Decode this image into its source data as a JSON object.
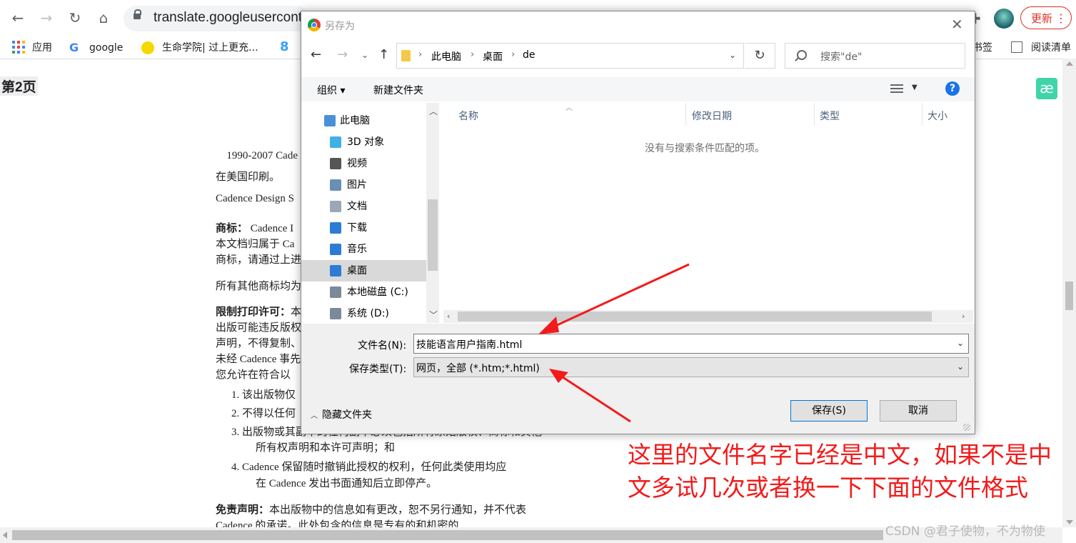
{
  "browser": {
    "url": "translate.googleusercont",
    "update_label": "更新",
    "bookmarks": [
      "应用",
      "google",
      "生命学院| 过上更充...",
      "书签",
      "阅读清单"
    ]
  },
  "page": {
    "heading": "第2页",
    "badge": "æ",
    "lines": [
      {
        "text": "\u0000 1990-2007 Cade",
        "bold": ""
      },
      {
        "text": "在美国印刷。",
        "bold": ""
      },
      {
        "text": "Cadence Design S",
        "bold": ""
      },
      {
        "text": " Cadence I",
        "bold": "商标："
      },
      {
        "text": "本文档归属于 Ca",
        "bold": ""
      },
      {
        "text": "商标，请通过上进",
        "bold": ""
      },
      {
        "text": "所有其他商标均为",
        "bold": ""
      },
      {
        "text": "本",
        "bold": "限制打印许可："
      },
      {
        "text": "出版可能违反版权",
        "bold": ""
      },
      {
        "text": "声明，不得复制、",
        "bold": ""
      },
      {
        "text": "未经 Cadence 事先",
        "bold": ""
      },
      {
        "text": "您允许在符合以",
        "bold": ""
      },
      {
        "text": "1. 该出版物仅",
        "bold": ""
      },
      {
        "text": "2. 不得以任何",
        "bold": ""
      },
      {
        "text": "3. 出版物或其副本的任何副本必须包括所有原始版权、商标和其他",
        "bold": ""
      },
      {
        "text": "所有权声明和本许可声明；和",
        "bold": ""
      },
      {
        "text": "4. Cadence 保留随时撤销此授权的权利，任何此类使用均应",
        "bold": ""
      },
      {
        "text": "在 Cadence 发出书面通知后立即停产。",
        "bold": ""
      },
      {
        "text": "本出版物中的信息如有更改，恕不另行通知，并不代表",
        "bold": "免责声明："
      },
      {
        "text": "Cadence 的承诺。此处包含的信息是专有的和机密的",
        "bold": ""
      }
    ]
  },
  "dialog": {
    "title": "另存为",
    "breadcrumb": [
      "此电脑",
      "桌面",
      "de"
    ],
    "search_placeholder": "搜索\"de\"",
    "toolbar": {
      "organize": "组织",
      "new_folder": "新建文件夹",
      "help": "?"
    },
    "tree": [
      {
        "label": "此电脑",
        "icon": "pc-icon"
      },
      {
        "label": "3D 对象",
        "icon": "3d-objects-icon"
      },
      {
        "label": "视频",
        "icon": "video-icon"
      },
      {
        "label": "图片",
        "icon": "pictures-icon"
      },
      {
        "label": "文档",
        "icon": "documents-icon"
      },
      {
        "label": "下载",
        "icon": "download-icon"
      },
      {
        "label": "音乐",
        "icon": "music-icon"
      },
      {
        "label": "桌面",
        "icon": "desktop-icon"
      },
      {
        "label": "本地磁盘 (C:)",
        "icon": "drive-c-icon"
      },
      {
        "label": "系统 (D:)",
        "icon": "drive-d-icon"
      }
    ],
    "selected_tree": "桌面",
    "columns": [
      "名称",
      "修改日期",
      "类型",
      "大小"
    ],
    "empty_message": "没有与搜索条件匹配的项。",
    "filename_label": "文件名(N):",
    "filename_value": "技能语言用户指南.html",
    "filetype_label": "保存类型(T):",
    "filetype_value": "网页，全部 (*.htm;*.html)",
    "hide_folders": "隐藏文件夹",
    "save": "保存(S)",
    "cancel": "取消"
  },
  "annotation": {
    "text": "这里的文件名字已经是中文，如果不是中文多试几次或者换一下下面的文件格式",
    "color": "#f21b1b"
  },
  "watermark": "CSDN @君子使物，不为物使"
}
